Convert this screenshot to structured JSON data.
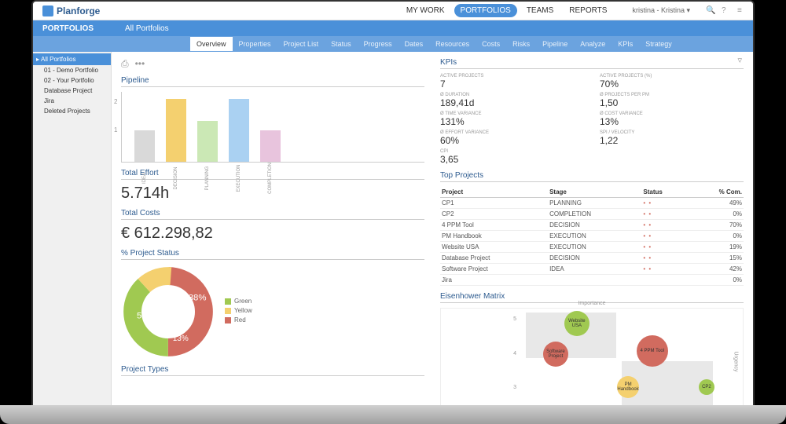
{
  "brand": "Planforge",
  "topnav": {
    "mywork": "MY WORK",
    "portfolios": "PORTFOLIOS",
    "teams": "TEAMS",
    "reports": "REPORTS",
    "user": "kristina - Kristina ▾"
  },
  "blueband": {
    "section": "PORTFOLIOS",
    "title": "All Portfolios"
  },
  "tabs": [
    "Overview",
    "Properties",
    "Project List",
    "Status",
    "Progress",
    "Dates",
    "Resources",
    "Costs",
    "Risks",
    "Pipeline",
    "Analyze",
    "KPIs",
    "Strategy"
  ],
  "sidebar": {
    "header": "All Portfolios",
    "items": [
      "01 - Demo Portfolio",
      "02 - Your Portfolio",
      "Database Project",
      "Jira",
      "Deleted Projects"
    ]
  },
  "pipeline": {
    "title": "Pipeline"
  },
  "chart_data": {
    "type": "bar",
    "categories": [
      "IDEA",
      "DECISION",
      "PLANNING",
      "EXECUTION",
      "COMPLETION"
    ],
    "values": [
      1,
      2,
      1.3,
      2,
      1
    ],
    "colors": [
      "#d9d9d9",
      "#f4d06f",
      "#cbe8b5",
      "#aad1f2",
      "#e8c4dd"
    ],
    "ylim": [
      0,
      2
    ]
  },
  "totalEffort": {
    "title": "Total Effort",
    "value": "5.714h"
  },
  "totalCosts": {
    "title": "Total Costs",
    "value": "€ 612.298,82"
  },
  "projectStatus": {
    "title": "% Project Status",
    "chart_data": {
      "type": "pie",
      "series": [
        {
          "name": "Green",
          "value": 38,
          "color": "#a0c951"
        },
        {
          "name": "Yellow",
          "value": 13,
          "color": "#f4d06f"
        },
        {
          "name": "Red",
          "value": 50,
          "color": "#d16b5f"
        }
      ]
    }
  },
  "projectTypes": {
    "title": "Project Types"
  },
  "kpis": {
    "title": "KPIs",
    "items": [
      {
        "lbl": "Active Projects",
        "val": "7"
      },
      {
        "lbl": "Active Projects (%)",
        "val": "70%"
      },
      {
        "lbl": "Ø Duration",
        "val": "189,41d"
      },
      {
        "lbl": "Ø Projects per PM",
        "val": "1,50"
      },
      {
        "lbl": "Ø Time Variance",
        "val": "131%"
      },
      {
        "lbl": "Ø Cost Variance",
        "val": "13%"
      },
      {
        "lbl": "Ø Effort Variance",
        "val": "60%"
      },
      {
        "lbl": "SPI / Velocity",
        "val": "1,22"
      },
      {
        "lbl": "CPI",
        "val": "3,65"
      },
      {
        "lbl": "",
        "val": ""
      }
    ]
  },
  "topProjects": {
    "title": "Top Projects",
    "headers": {
      "project": "Project",
      "stage": "Stage",
      "status": "Status",
      "com": "% Com."
    },
    "rows": [
      {
        "p": "CP1",
        "s": "PLANNING",
        "st": "•  •",
        "c": "49%"
      },
      {
        "p": "CP2",
        "s": "COMPLETION",
        "st": "•  •",
        "c": "0%"
      },
      {
        "p": "4 PPM Tool",
        "s": "DECISION",
        "st": "•  •",
        "c": "70%"
      },
      {
        "p": "PM Handbook",
        "s": "EXECUTION",
        "st": "•  •",
        "c": "0%"
      },
      {
        "p": "Website USA",
        "s": "EXECUTION",
        "st": "•  •",
        "c": "19%"
      },
      {
        "p": "Database Project",
        "s": "DECISION",
        "st": "•  •",
        "c": "15%"
      },
      {
        "p": "Software Project",
        "s": "IDEA",
        "st": "•  •",
        "c": "42%"
      },
      {
        "p": "Jira",
        "s": "",
        "st": "",
        "c": "0%"
      }
    ]
  },
  "eisenhower": {
    "title": "Eisenhower Matrix",
    "xlabel": "Importance",
    "ylabel": "Urgency",
    "bubbles": [
      {
        "name": "Website USA",
        "x": 45,
        "y": 15,
        "r": 16,
        "color": "#a0c951"
      },
      {
        "name": "4 PPM Tool",
        "x": 70,
        "y": 42,
        "r": 20,
        "color": "#d16b5f"
      },
      {
        "name": "Software Project",
        "x": 38,
        "y": 45,
        "r": 16,
        "color": "#d16b5f"
      },
      {
        "name": "PM Handbook",
        "x": 62,
        "y": 78,
        "r": 14,
        "color": "#f4d06f"
      },
      {
        "name": "CP2",
        "x": 88,
        "y": 78,
        "r": 10,
        "color": "#a0c951"
      }
    ],
    "ticks": [
      "5",
      "4",
      "3"
    ]
  }
}
